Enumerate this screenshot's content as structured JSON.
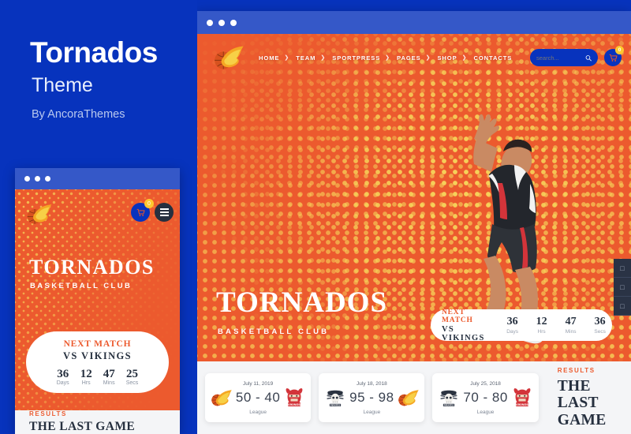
{
  "promo": {
    "title": "Tornados",
    "subtitle": "Theme",
    "author": "By AncoraThemes"
  },
  "browser": {
    "titlebar_dots": 3
  },
  "site": {
    "logo_name": "tornados-flame-basketball-logo",
    "nav": [
      {
        "label": "HOME",
        "has_caret": true
      },
      {
        "label": "TEAM",
        "has_caret": true
      },
      {
        "label": "SPORTPRESS",
        "has_caret": true
      },
      {
        "label": "PAGES",
        "has_caret": true
      },
      {
        "label": "SHOP",
        "has_caret": true
      },
      {
        "label": "CONTACTS",
        "has_caret": false
      }
    ],
    "search": {
      "placeholder": "search...",
      "value": ""
    },
    "cart": {
      "count": "0"
    }
  },
  "hero": {
    "title": "TORNADOS",
    "subtitle": "BASKETBALL CLUB",
    "countdown": {
      "kicker": "NEXT MATCH",
      "opponent": "VS VIKINGS",
      "items": [
        {
          "value": "36",
          "label": "Days"
        },
        {
          "value": "12",
          "label": "Hrs"
        },
        {
          "value": "47",
          "label": "Mins"
        },
        {
          "value": "36",
          "label": "Secs"
        }
      ]
    },
    "social": [
      {
        "name": "facebook-icon",
        "glyph": "□"
      },
      {
        "name": "twitter-icon",
        "glyph": "□"
      },
      {
        "name": "instagram-icon",
        "glyph": "□"
      }
    ]
  },
  "results": {
    "kicker": "RESULTS",
    "title_line1": "THE LAST",
    "title_line2": "GAME",
    "cards": [
      {
        "date": "July 11, 2019",
        "score": "50 - 40",
        "league": "League",
        "home_logo": "tornados-logo",
        "away_logo": "vikings-logo"
      },
      {
        "date": "July 18, 2018",
        "score": "95 - 98",
        "league": "League",
        "home_logo": "pirates-logo",
        "away_logo": "tornados-logo"
      },
      {
        "date": "July 25, 2018",
        "score": "70 - 80",
        "league": "League",
        "home_logo": "pirates-logo",
        "away_logo": "vikings-logo"
      }
    ]
  },
  "mobile": {
    "cart": {
      "count": "0"
    },
    "title": "TORNADOS",
    "subtitle": "BASKETBALL CLUB",
    "countdown": {
      "kicker": "NEXT MATCH",
      "opponent": "VS VIKINGS",
      "items": [
        {
          "value": "36",
          "label": "Days"
        },
        {
          "value": "12",
          "label": "Hrs"
        },
        {
          "value": "47",
          "label": "Mins"
        },
        {
          "value": "25",
          "label": "Secs"
        }
      ]
    },
    "results": {
      "kicker": "RESULTS",
      "title": "THE LAST GAME"
    }
  },
  "colors": {
    "brand_blue": "#0733bd",
    "titlebar_blue": "#3558c8",
    "orange": "#ec5a2e",
    "yellow": "#f6d35a",
    "navy": "#26303f",
    "light_gray": "#f4f5f7"
  }
}
